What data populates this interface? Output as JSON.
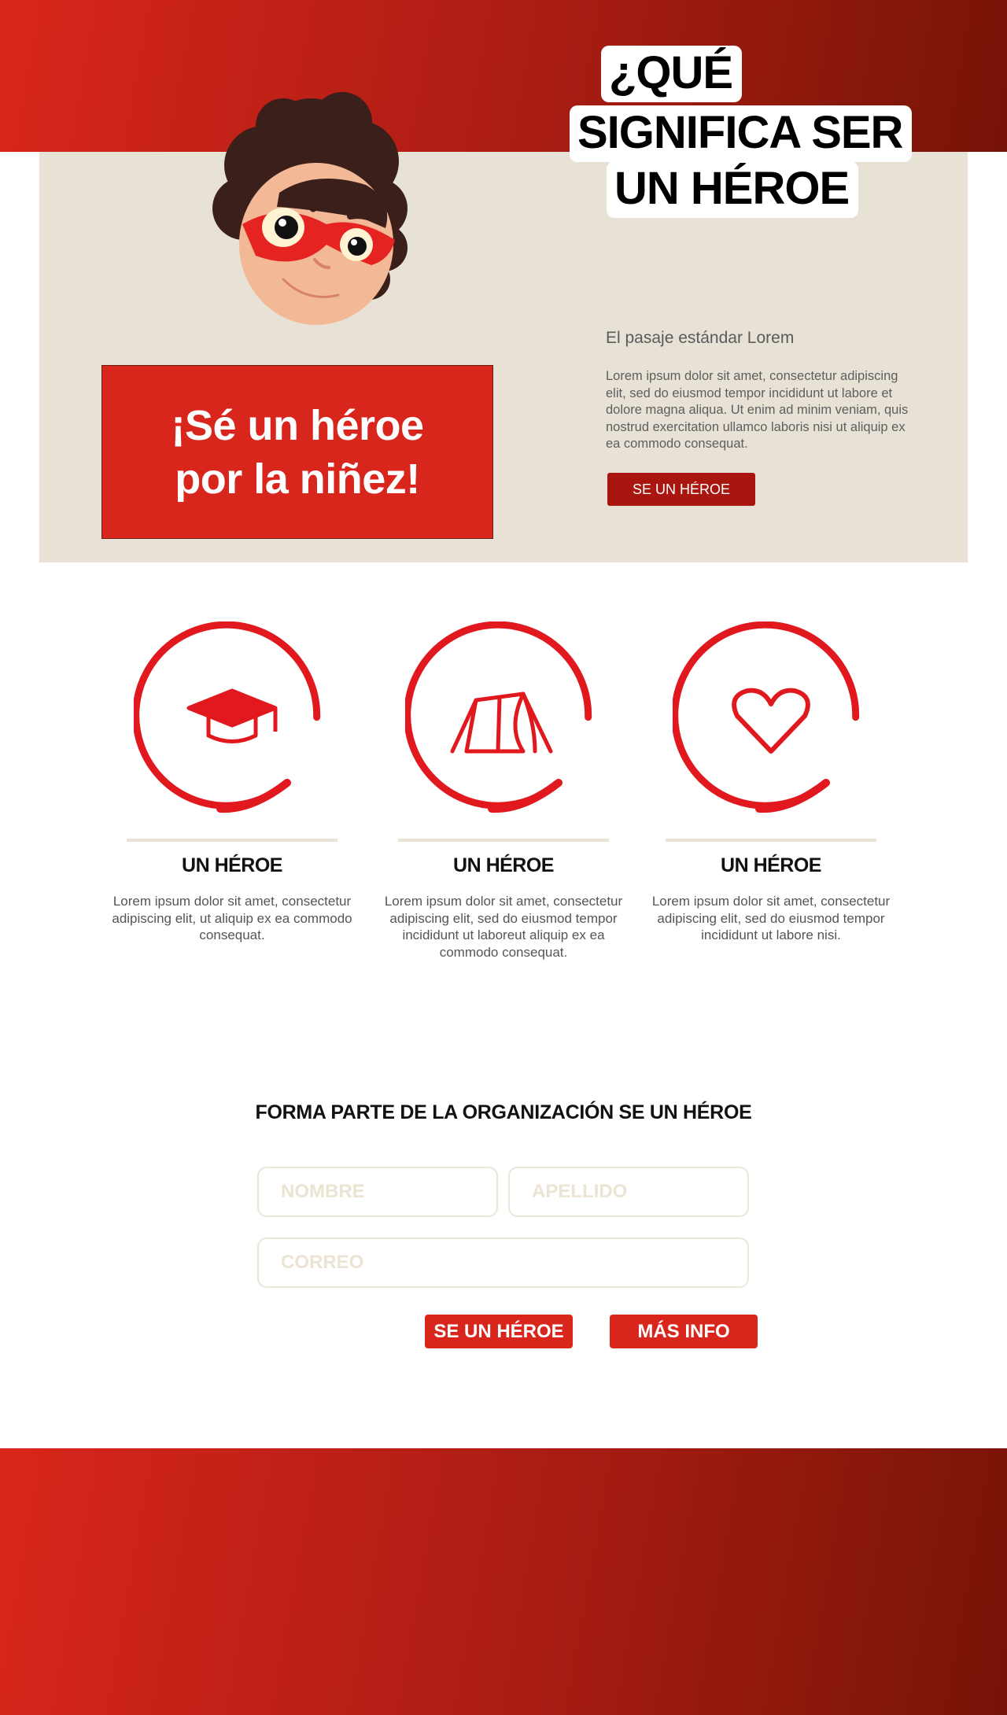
{
  "hero": {
    "title_lines": [
      "¿QUÉ",
      "SIGNIFICA SER",
      "UN HÉROE"
    ],
    "cta_lines": [
      "¡Sé un héroe",
      "por la niñez!"
    ],
    "intro_heading": "El pasaje estándar Lorem",
    "intro_text": "Lorem ipsum dolor sit amet, consectetur adipiscing elit, sed do eiusmod tempor incididunt ut labore et dolore magna aliqua. Ut enim ad minim veniam, quis nostrud exercitation ullamco laboris nisi ut aliquip ex ea commodo consequat.",
    "button_label": "SE UN HÉROE"
  },
  "features": [
    {
      "icon": "graduation-cap-icon",
      "title": "UN HÉROE",
      "text": "Lorem ipsum dolor sit amet, consectetur adipiscing elit, ut aliquip ex ea commodo consequat."
    },
    {
      "icon": "tent-icon",
      "title": "UN HÉROE",
      "text": "Lorem ipsum dolor sit amet, consectetur adipiscing elit, sed do eiusmod tempor incididunt ut laboreut aliquip ex ea commodo consequat."
    },
    {
      "icon": "heart-icon",
      "title": "UN HÉROE",
      "text": "Lorem ipsum dolor sit amet, consectetur adipiscing elit, sed do eiusmod tempor incididunt ut labore  nisi."
    }
  ],
  "form": {
    "title": "FORMA PARTE DE LA ORGANIZACIÓN SE UN HÉROE",
    "name_placeholder": "NOMBRE",
    "lastname_placeholder": "APELLIDO",
    "email_placeholder": "CORREO",
    "submit_label": "SE UN HÉROE",
    "info_label": "MÁS INFO"
  },
  "colors": {
    "brand_red": "#d9261c",
    "dark_red": "#a9150f",
    "gradient_end": "#761407",
    "panel_beige": "#e7e2d5"
  }
}
